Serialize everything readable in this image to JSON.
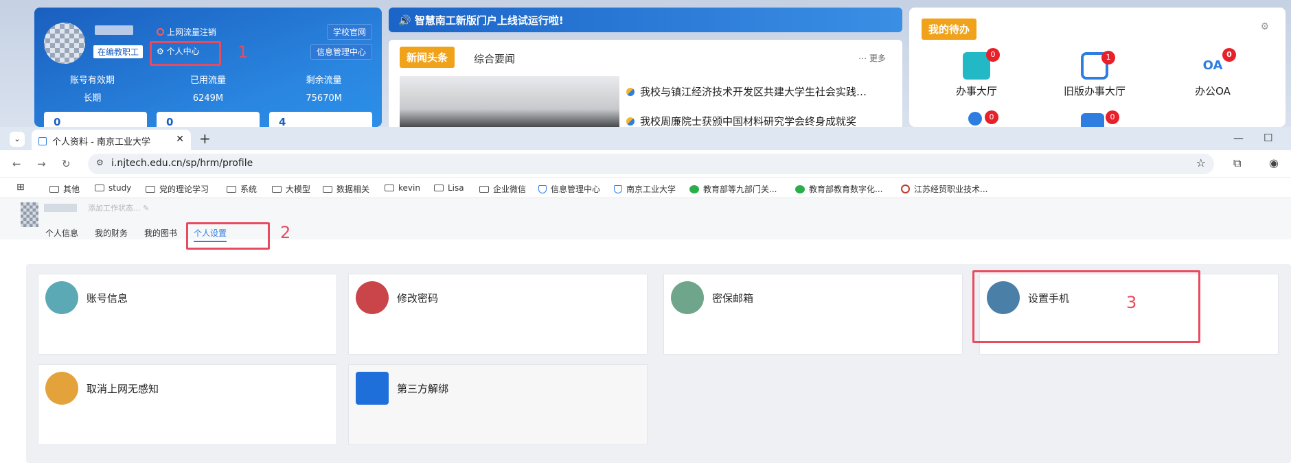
{
  "portal": {
    "user": {
      "staff_tag": "在编教职工",
      "logout": "上网流量注销",
      "center": "个人中心",
      "site_btn": "学校官网",
      "info_btn": "信息管理中心",
      "stats": [
        {
          "label": "账号有效期",
          "value": "长期"
        },
        {
          "label": "已用流量",
          "value": "6249M"
        },
        {
          "label": "剩余流量",
          "value": "75670M"
        }
      ],
      "box_values": [
        "0",
        "0",
        "4"
      ]
    },
    "notice": "智慧南工新版门户上线试运行啦!",
    "news": {
      "tab_hot": "新闻头条",
      "tab_general": "综合要闻",
      "more": "更多",
      "items": [
        "我校与镇江经济技术开发区共建大学生社会实践…",
        "我校周廉院士获颁中国材料研究学会终身成就奖"
      ]
    },
    "todo": {
      "title": "我的待办",
      "items": [
        {
          "label": "办事大厅",
          "badge": "0",
          "icon": "hall-icon",
          "color": "#22b8c6"
        },
        {
          "label": "旧版办事大厅",
          "badge": "1",
          "icon": "grid-icon",
          "color": "#2f7de1"
        },
        {
          "label": "办公OA",
          "badge": "0",
          "icon": "oa-icon",
          "color": "#2f7de1"
        }
      ],
      "row2_badges": [
        "0",
        "0"
      ]
    }
  },
  "annotations": {
    "one": "1",
    "two": "2",
    "three": "3"
  },
  "browser": {
    "tab_title": "个人资料 - 南京工业大学",
    "url": "i.njtech.edu.cn/sp/hrm/profile",
    "bookmarks": [
      {
        "label": "其他",
        "icon": "folder-icon"
      },
      {
        "label": "study",
        "icon": "folder-icon"
      },
      {
        "label": "党的理论学习",
        "icon": "folder-icon"
      },
      {
        "label": "系统",
        "icon": "folder-icon"
      },
      {
        "label": "大模型",
        "icon": "folder-icon"
      },
      {
        "label": "数据相关",
        "icon": "folder-icon"
      },
      {
        "label": "kevin",
        "icon": "folder-icon"
      },
      {
        "label": "Lisa",
        "icon": "folder-icon"
      },
      {
        "label": "企业微信",
        "icon": "folder-icon"
      },
      {
        "label": "信息管理中心",
        "icon": "shield-icon"
      },
      {
        "label": "南京工业大学",
        "icon": "shield-icon"
      },
      {
        "label": "教育部等九部门关...",
        "icon": "wechat-icon"
      },
      {
        "label": "教育部教育数字化...",
        "icon": "wechat-icon"
      },
      {
        "label": "江苏经贸职业技术...",
        "icon": "seal-icon"
      }
    ]
  },
  "profile": {
    "status": "添加工作状态...",
    "tabs": [
      "个人信息",
      "我的财务",
      "我的图书",
      "个人设置"
    ],
    "active_tab": "个人设置"
  },
  "settings": [
    {
      "label": "账号信息",
      "icon": "id-card-icon",
      "color": "#5aa9b5"
    },
    {
      "label": "修改密码",
      "icon": "key-icon",
      "color": "#c9454a"
    },
    {
      "label": "密保邮箱",
      "icon": "mailbox-icon",
      "color": "#6fa58a"
    },
    {
      "label": "设置手机",
      "icon": "phone-icon",
      "color": "#4a7fa8"
    },
    {
      "label": "取消上网无感知",
      "icon": "browser-icon",
      "color": "#e3a33a"
    },
    {
      "label": "第三方解绑",
      "icon": "unbind-icon",
      "color": "#1e6fd9"
    }
  ]
}
